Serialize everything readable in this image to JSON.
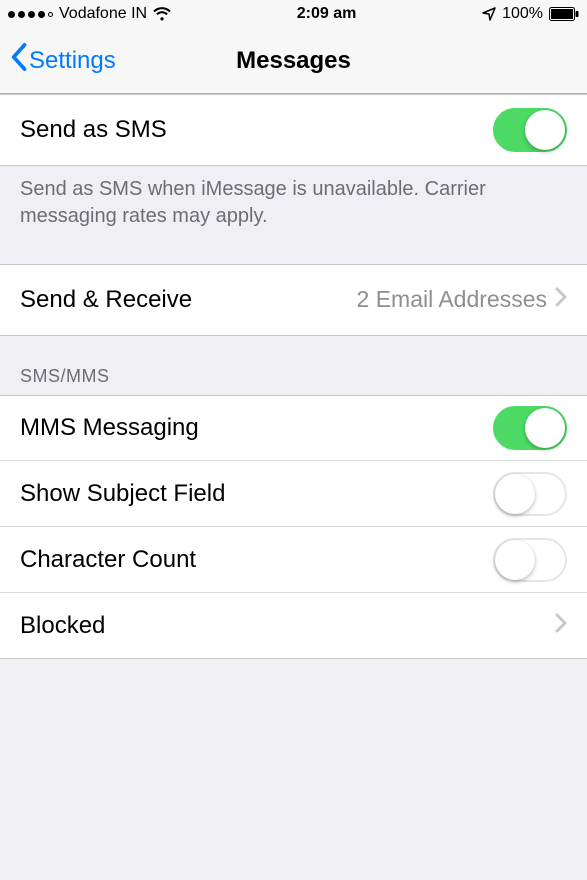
{
  "status": {
    "carrier": "Vodafone IN",
    "time": "2:09 am",
    "battery_pct": "100%"
  },
  "nav": {
    "back_label": "Settings",
    "title": "Messages"
  },
  "rows": {
    "send_as_sms": {
      "label": "Send as SMS",
      "on": true
    },
    "send_as_sms_footer": "Send as SMS when iMessage is unavailable. Carrier messaging rates may apply.",
    "send_receive": {
      "label": "Send & Receive",
      "detail": "2 Email Addresses"
    },
    "section_sms_mms": "SMS/MMS",
    "mms_messaging": {
      "label": "MMS Messaging",
      "on": true
    },
    "show_subject": {
      "label": "Show Subject Field",
      "on": false
    },
    "char_count": {
      "label": "Character Count",
      "on": false
    },
    "blocked": {
      "label": "Blocked"
    }
  }
}
